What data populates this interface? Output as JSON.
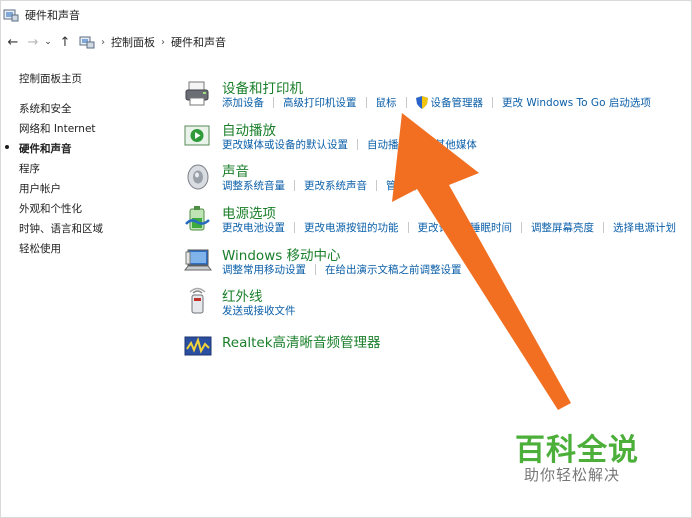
{
  "window": {
    "title": "硬件和声音"
  },
  "address": {
    "crumbs": [
      "控制面板",
      "硬件和声音"
    ]
  },
  "sidebar": {
    "home": "控制面板主页",
    "items": [
      "系统和安全",
      "网络和 Internet",
      "硬件和声音",
      "程序",
      "用户帐户",
      "外观和个性化",
      "时钟、语言和区域",
      "轻松使用"
    ],
    "current_index": 2
  },
  "categories": [
    {
      "icon": "printer-icon",
      "title": "设备和打印机",
      "links": [
        "添加设备",
        "高级打印机设置",
        "鼠标",
        "设备管理器",
        "更改 Windows To Go 启动选项"
      ]
    },
    {
      "icon": "autoplay-icon",
      "title": "自动播放",
      "links": [
        "更改媒体或设备的默认设置",
        "自动播放CD或其他媒体"
      ]
    },
    {
      "icon": "speaker-icon",
      "title": "声音",
      "links": [
        "调整系统音量",
        "更改系统声音",
        "管理音频设备"
      ]
    },
    {
      "icon": "power-icon",
      "title": "电源选项",
      "links": [
        "更改电池设置",
        "更改电源按钮的功能",
        "更改计算机睡眠时间",
        "调整屏幕亮度",
        "选择电源计划"
      ]
    },
    {
      "icon": "mobility-center-icon",
      "title": "Windows 移动中心",
      "links": [
        "调整常用移动设置",
        "在给出演示文稿之前调整设置"
      ]
    },
    {
      "icon": "infrared-icon",
      "title": "红外线",
      "links": [
        "发送或接收文件"
      ]
    },
    {
      "icon": "realtek-audio-icon",
      "title": "Realtek高清晰音频管理器",
      "links": []
    }
  ],
  "colors": {
    "category_title": "#1a7f2a",
    "link": "#0b5fa8",
    "arrow": "#f26f21",
    "watermark": "#4caf3a"
  },
  "watermark": {
    "main": "百科全说",
    "sub": "助你轻松解决"
  }
}
